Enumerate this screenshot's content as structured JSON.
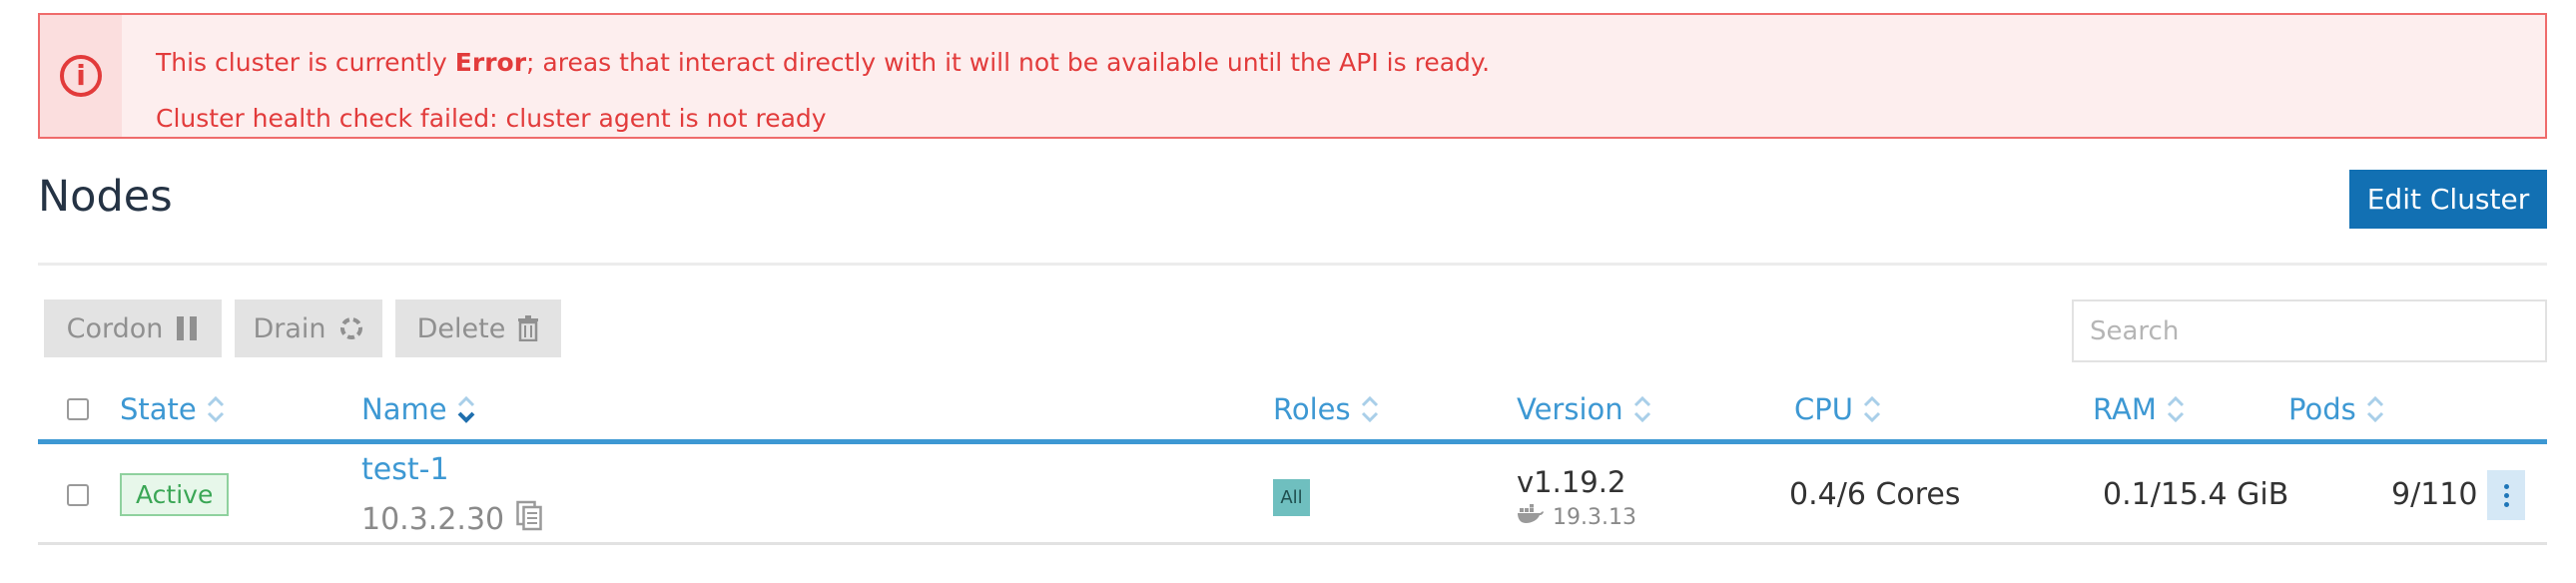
{
  "banner": {
    "icon": "info-circle-icon",
    "line1_prefix": "This cluster is currently ",
    "line1_state": "Error",
    "line1_suffix": "; areas that interact directly with it will not be available until the API is ready.",
    "line2": "Cluster health check failed: cluster agent is not ready",
    "colors": {
      "border": "#ef6b6b",
      "text": "#e23b3b",
      "background": "#fdeeee"
    }
  },
  "header": {
    "title": "Nodes",
    "edit_button": "Edit Cluster",
    "accent": "#1270b3"
  },
  "toolbar": {
    "cordon_label": "Cordon",
    "cordon_icon": "pause-icon",
    "drain_label": "Drain",
    "drain_icon": "drain-icon",
    "delete_label": "Delete",
    "delete_icon": "trash-icon"
  },
  "search": {
    "placeholder": "Search",
    "value": ""
  },
  "table": {
    "columns": [
      {
        "label": "State",
        "sort": "none"
      },
      {
        "label": "Name",
        "sort": "ascending"
      },
      {
        "label": "Roles",
        "sort": "none"
      },
      {
        "label": "Version",
        "sort": "none"
      },
      {
        "label": "CPU",
        "sort": "none"
      },
      {
        "label": "RAM",
        "sort": "none"
      },
      {
        "label": "Pods",
        "sort": "none"
      }
    ],
    "rows": [
      {
        "state": "Active",
        "name": "test-1",
        "ip": "10.3.2.30",
        "role": "All",
        "version": "v1.19.2",
        "docker_version": "19.3.13",
        "cpu": "0.4/6 Cores",
        "ram": "0.1/15.4 GiB",
        "pods": "9/110"
      }
    ],
    "accent": "#3d98d3"
  }
}
